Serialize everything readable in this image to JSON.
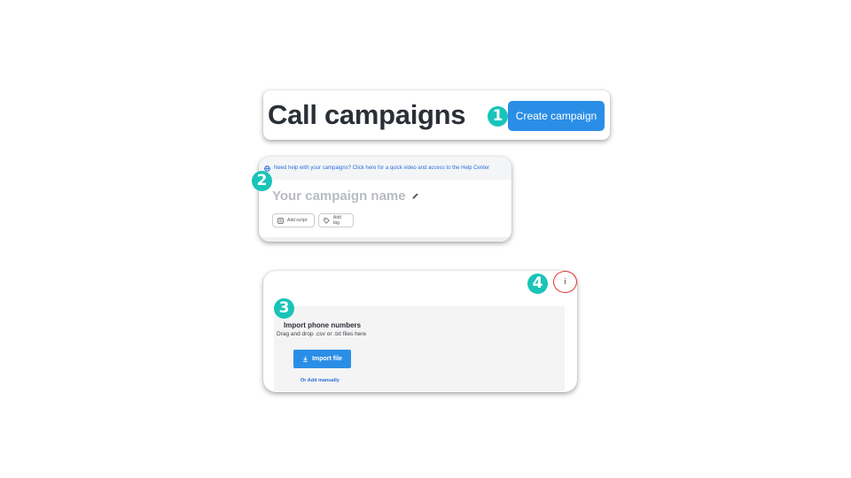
{
  "header": {
    "title": "Call campaigns",
    "create_button_label": "Create campaign",
    "marker": "1"
  },
  "campaign": {
    "help_text": "Need help with your campaigns? Click here for a quick video and access to the Help Center",
    "name_placeholder": "Your campaign name",
    "add_script_label": "Add script",
    "add_tag_label": "Add tag",
    "marker": "2"
  },
  "import": {
    "title": "Import phone numbers",
    "subtitle": "Drag and drop .csv or .txt files here",
    "import_button_label": "Import file",
    "add_manually_label": "Or Add manually",
    "info_label": "i",
    "marker_import": "3",
    "marker_info": "4"
  },
  "colors": {
    "accent": "#2b8ee6",
    "marker": "#19c4b8",
    "highlight_ring": "#e0362c"
  },
  "icons": [
    "globe-icon",
    "pencil-icon",
    "script-icon",
    "tag-icon",
    "download-icon",
    "info-icon"
  ]
}
